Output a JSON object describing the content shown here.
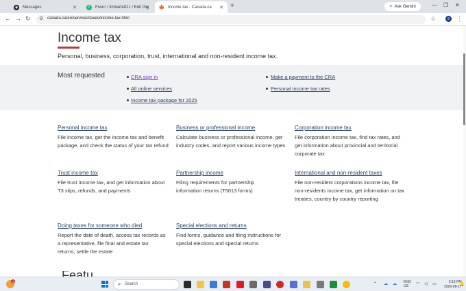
{
  "browser": {
    "tabs": [
      {
        "label": "Messages",
        "color": "#202124",
        "glyph": "◉"
      },
      {
        "label": "Fiverr / timbarlett21 / Edit Gig",
        "color": "#1dbf73",
        "glyph": "f"
      },
      {
        "label": "Income tax - Canada.ca",
        "color": "#d52b1e",
        "glyph": "🍁"
      }
    ],
    "new_tab": "+",
    "gemini_label": "Ask Gemini",
    "url": "canada.ca/en/services/taxes/income-tax.html",
    "profile_initial": "9"
  },
  "page": {
    "title": "Income tax",
    "lead": "Personal, business, corporation, trust, international and non-resident income tax.",
    "most_requested": {
      "heading": "Most requested",
      "links_col1": [
        "CRA sign in",
        "All online services",
        "Income tax package for 2025"
      ],
      "links_col2": [
        "Make a payment to the CRA",
        "Personal income tax rates"
      ]
    },
    "cards": [
      {
        "title": "Personal income tax",
        "desc": "File income tax, get the income tax and benefit package, and check the status of your tax refund"
      },
      {
        "title": "Business or professional income",
        "desc": "Calculate business or professional income, get industry codes, and report various income types"
      },
      {
        "title": "Corporation income tax",
        "desc": "File corporation income tax, find tax rates, and get information about provincial and territorial corporate tax"
      },
      {
        "title": "Trust income tax",
        "desc": "File trust income tax, and get information about T3 slips, refunds, and payments"
      },
      {
        "title": "Partnership income",
        "desc": "Filing requirements for partnership information returns (T5013 forms)"
      },
      {
        "title": "International and non-resident taxes",
        "desc": "File non-resident corporations income tax, file non-residents income tax, get information on tax treaties, country by country reporting"
      },
      {
        "title": "Doing taxes for someone who died",
        "desc": "Report the date of death, access tax records as a representative, file final and estate tax returns, settle the estate"
      },
      {
        "title": "Special elections and returns",
        "desc": "Find forms, guidance and filing instructions for special elections and special returns"
      }
    ],
    "partial_heading": "Featu"
  },
  "taskbar": {
    "weather_badge": "3",
    "search_label": "Search",
    "lang_line1": "ENG",
    "lang_line2": "US",
    "time": "5:12 PM",
    "date": "2026-08-17"
  }
}
